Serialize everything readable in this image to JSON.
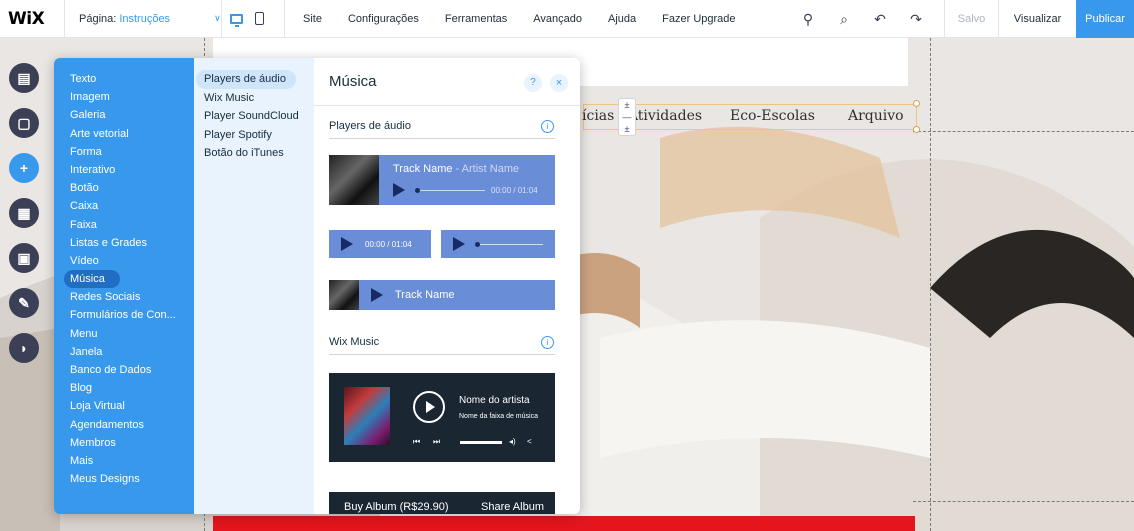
{
  "topbar": {
    "logo": "WiX",
    "page_label": "Página:",
    "page_value": "Instruções",
    "menu": [
      "Site",
      "Configurações",
      "Ferramentas",
      "Avançado",
      "Ajuda",
      "Fazer Upgrade"
    ],
    "saved": "Salvo",
    "preview": "Visualizar",
    "publish": "Publicar"
  },
  "site_nav": {
    "item1": "ícias / Atividades",
    "item2": "Eco-Escolas",
    "item3": "Arquivo"
  },
  "categories": [
    "Texto",
    "Imagem",
    "Galeria",
    "Arte vetorial",
    "Forma",
    "Interativo",
    "Botão",
    "Caixa",
    "Faixa",
    "Listas e Grades",
    "Vídeo",
    "Música",
    "Redes Sociais",
    "Formulários de Con...",
    "Menu",
    "Janela",
    "Banco de Dados",
    "Blog",
    "Loja Virtual",
    "Agendamentos",
    "Membros",
    "Mais",
    "Meus Designs"
  ],
  "selected_category": "Música",
  "subcategories": [
    "Players de áudio",
    "Wix Music",
    "Player SoundCloud",
    "Player Spotify",
    "Botão do iTunes"
  ],
  "panel": {
    "title": "Música",
    "help": "?",
    "close": "×",
    "section1": "Players de áudio",
    "section2": "Wix Music",
    "info": "i"
  },
  "players": {
    "track_name": "Track Name",
    "separator": " - ",
    "artist_name": "Artist Name",
    "time_full": "00:00 / 01:04",
    "time_short": "00:00 / 01:04",
    "track_name_strip": "Track Name"
  },
  "wix_music": {
    "artist": "Nome do artista",
    "track": "Nome da faixa de música",
    "buy": "Buy Album (R$29.90)",
    "share": "Share Album"
  },
  "colors": {
    "accent": "#3899ec",
    "player_blue": "#6a8dd8",
    "dark": "#1b2633",
    "red_bar": "#e5151d"
  }
}
